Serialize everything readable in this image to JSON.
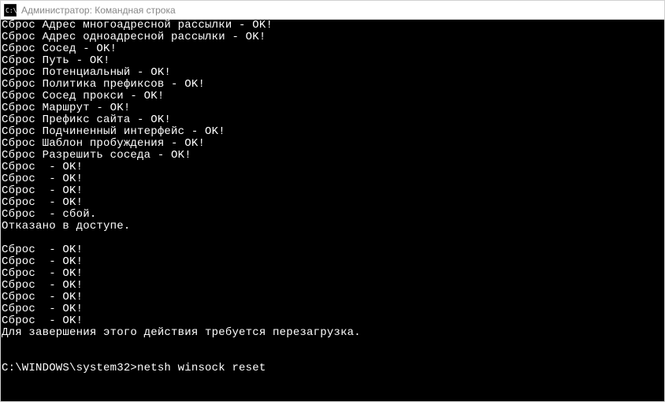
{
  "window": {
    "title": "Администратор: Командная строка"
  },
  "terminal": {
    "lines": [
      "Сброс Адрес многоадресной рассылки - OK!",
      "Сброс Адрес одноадресной рассылки - OK!",
      "Сброс Сосед - OK!",
      "Сброс Путь - OK!",
      "Сброс Потенциальный - OK!",
      "Сброс Политика префиксов - OK!",
      "Сброс Сосед прокси - OK!",
      "Сброс Маршрут - OK!",
      "Сброс Префикс сайта - OK!",
      "Сброс Подчиненный интерфейс - OK!",
      "Сброс Шаблон пробуждения - OK!",
      "Сброс Разрешить соседа - OK!",
      "Сброс  - OK!",
      "Сброс  - OK!",
      "Сброс  - OK!",
      "Сброс  - OK!",
      "Сброс  - сбой.",
      "Отказано в доступе.",
      "",
      "Сброс  - OK!",
      "Сброс  - OK!",
      "Сброс  - OK!",
      "Сброс  - OK!",
      "Сброс  - OK!",
      "Сброс  - OK!",
      "Сброс  - OK!",
      "Для завершения этого действия требуется перезагрузка.",
      "",
      ""
    ],
    "prompt": "C:\\WINDOWS\\system32>",
    "command": "netsh winsock reset"
  }
}
